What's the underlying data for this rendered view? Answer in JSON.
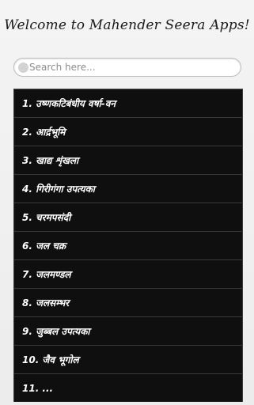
{
  "header": {
    "title": "Welcome to Mahender Seera Apps!"
  },
  "search": {
    "placeholder": "Search here..."
  },
  "list": {
    "items": [
      {
        "label": "1. उष्णकटिबंधीय वर्षा-वन"
      },
      {
        "label": "2. आर्द्रभूमि"
      },
      {
        "label": "3. खाद्य शृंखला"
      },
      {
        "label": "4. गिरीगंगा उपत्यका"
      },
      {
        "label": "5. चरमपसंदी"
      },
      {
        "label": "6. जल चक्र"
      },
      {
        "label": "7. जलमण्डल"
      },
      {
        "label": "8. जलसम्भर"
      },
      {
        "label": "9. जुब्बल उपत्यका"
      },
      {
        "label": "10. जैव भूगोल"
      },
      {
        "label": "11. ..."
      }
    ]
  }
}
